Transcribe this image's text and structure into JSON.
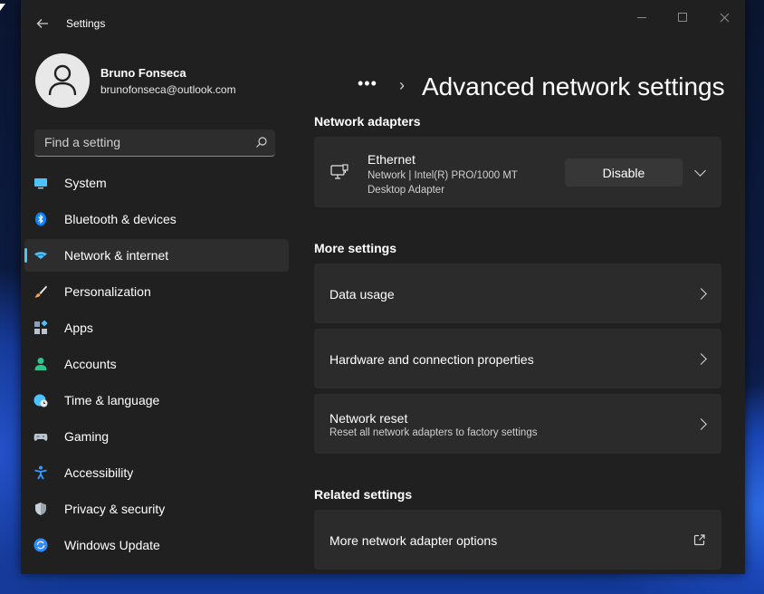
{
  "app": {
    "title": "Settings"
  },
  "profile": {
    "name": "Bruno Fonseca",
    "email": "brunofonseca@outlook.com"
  },
  "search": {
    "placeholder": "Find a setting"
  },
  "nav": {
    "items": [
      {
        "label": "System",
        "icon": "monitor-icon",
        "color": "#4cc2ff"
      },
      {
        "label": "Bluetooth & devices",
        "icon": "bluetooth-icon",
        "color": "#0a84ff"
      },
      {
        "label": "Network & internet",
        "icon": "wifi-icon",
        "color": "#4cc2ff"
      },
      {
        "label": "Personalization",
        "icon": "brush-icon",
        "color": "#f0a050"
      },
      {
        "label": "Apps",
        "icon": "apps-icon",
        "color": "#b8c4d0"
      },
      {
        "label": "Accounts",
        "icon": "person-icon",
        "color": "#2fc28a"
      },
      {
        "label": "Time & language",
        "icon": "globe-clock-icon",
        "color": "#4cc2ff"
      },
      {
        "label": "Gaming",
        "icon": "gamepad-icon",
        "color": "#b8c4d0"
      },
      {
        "label": "Accessibility",
        "icon": "accessibility-icon",
        "color": "#3a9bff"
      },
      {
        "label": "Privacy & security",
        "icon": "shield-icon",
        "color": "#9aa4ad"
      },
      {
        "label": "Windows Update",
        "icon": "update-icon",
        "color": "#2f8bff"
      }
    ],
    "selected_index": 2
  },
  "main": {
    "breadcrumb_more": "•••",
    "breadcrumb_separator": "›",
    "title": "Advanced network settings",
    "adapters_section": "Network adapters",
    "adapter": {
      "name": "Ethernet",
      "description": "Network | Intel(R) PRO/1000 MT Desktop Adapter",
      "button": "Disable"
    },
    "more_section": "More settings",
    "data_usage": "Data usage",
    "hardware": "Hardware and connection properties",
    "reset": {
      "label": "Network reset",
      "description": "Reset all network adapters to factory settings"
    },
    "related_section": "Related settings",
    "more_adapter_options": "More network adapter options"
  },
  "colors": {
    "accent": "#4cc2ff",
    "window_bg": "#202020",
    "card_bg": "#2b2b2b"
  }
}
